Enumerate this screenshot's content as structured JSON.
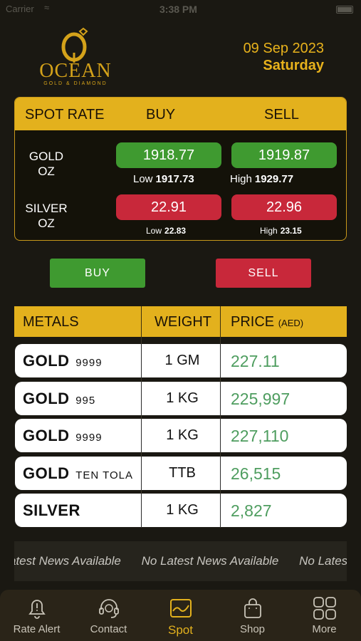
{
  "status_bar": {
    "carrier": "Carrier",
    "time": "3:38 PM"
  },
  "brand": {
    "name": "OCEAN",
    "tagline": "GOLD & DIAMOND"
  },
  "date": {
    "date": "09 Sep 2023",
    "day": "Saturday"
  },
  "spot": {
    "header": {
      "title": "SPOT RATE",
      "buy": "BUY",
      "sell": "SELL"
    },
    "rows": [
      {
        "metal_line1": "GOLD",
        "metal_line2": "OZ",
        "buy": "1918.77",
        "sell": "1919.87",
        "low_label": "Low",
        "low": "1917.73",
        "high_label": "High",
        "high": "1929.77"
      },
      {
        "metal_line1": "SILVER",
        "metal_line2": "OZ",
        "buy": "22.91",
        "sell": "22.96",
        "low_label": "Low",
        "low": "22.83",
        "high_label": "High",
        "high": "23.15"
      }
    ]
  },
  "actions": {
    "buy": "BUY",
    "sell": "SELL"
  },
  "metals_table": {
    "headers": {
      "metals": "METALS",
      "weight": "WEIGHT",
      "price": "PRICE",
      "price_unit": "(AED)"
    },
    "rows": [
      {
        "name": "GOLD",
        "purity": "9999",
        "weight": "1 GM",
        "price": "227.11"
      },
      {
        "name": "GOLD",
        "purity": "995",
        "weight": "1 KG",
        "price": "225,997"
      },
      {
        "name": "GOLD",
        "purity": "9999",
        "weight": "1 KG",
        "price": "227,110"
      },
      {
        "name": "GOLD",
        "purity": "TEN TOLA",
        "weight": "TTB",
        "price": "26,515"
      },
      {
        "name": "SILVER",
        "purity": "",
        "weight": "1 KG",
        "price": "2,827"
      }
    ]
  },
  "news": {
    "items": [
      "atest News Available",
      "No Latest News Available",
      "No Lates"
    ]
  },
  "tabs": [
    {
      "label": "Rate Alert",
      "icon": "bell-alert-icon"
    },
    {
      "label": "Contact",
      "icon": "headset-icon"
    },
    {
      "label": "Spot",
      "icon": "chart-icon"
    },
    {
      "label": "Shop",
      "icon": "shopping-bag-icon"
    },
    {
      "label": "More",
      "icon": "grid-icon"
    }
  ],
  "colors": {
    "gold": "#e3b11d",
    "green": "#3f9a30",
    "red": "#c8283a",
    "price_green": "#4e9d5f"
  }
}
